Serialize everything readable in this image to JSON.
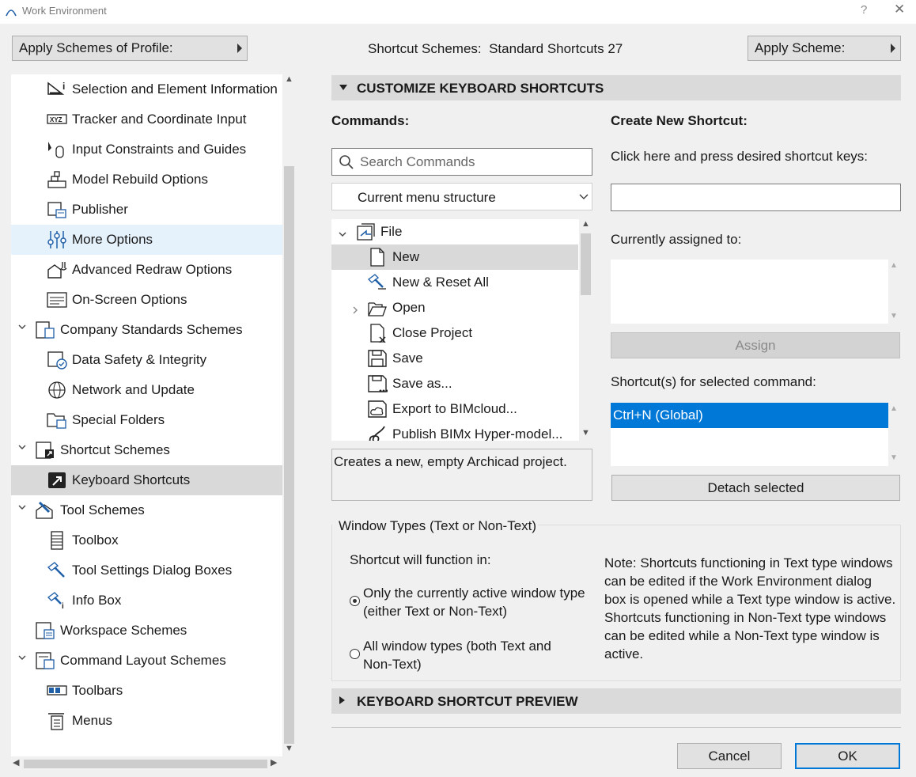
{
  "window": {
    "title": "Work Environment",
    "help": "?",
    "close": "✕"
  },
  "top": {
    "apply_profile": "Apply Schemes of Profile:",
    "scheme_label": "Shortcut Schemes",
    "scheme_sep": ":",
    "scheme_value": "Standard Shortcuts 27",
    "apply_scheme": "Apply Scheme:"
  },
  "tree": [
    {
      "label": "Selection and Element Information",
      "icon": "selection-info-icon",
      "level": 2
    },
    {
      "label": "Tracker and Coordinate Input",
      "icon": "xyz-tracker-icon",
      "level": 2
    },
    {
      "label": "Input Constraints and Guides",
      "icon": "cursor-mouse-icon",
      "level": 2
    },
    {
      "label": "Model Rebuild Options",
      "icon": "wall-rebuild-icon",
      "level": 2
    },
    {
      "label": "Publisher",
      "icon": "publisher-icon",
      "level": 2
    },
    {
      "label": "More Options",
      "icon": "sliders-icon",
      "level": 2
    },
    {
      "label": "Advanced Redraw Options",
      "icon": "redraw-icon",
      "level": 2
    },
    {
      "label": "On-Screen Options",
      "icon": "screen-options-icon",
      "level": 2
    },
    {
      "label": "Company Standards Schemes",
      "icon": "company-standards-icon",
      "level": 1
    },
    {
      "label": "Data Safety & Integrity",
      "icon": "data-safety-icon",
      "level": 2
    },
    {
      "label": "Network and Update",
      "icon": "globe-icon",
      "level": 2
    },
    {
      "label": "Special Folders",
      "icon": "folder-icon",
      "level": 2
    },
    {
      "label": "Shortcut Schemes",
      "icon": "shortcut-schemes-icon",
      "level": 1
    },
    {
      "label": "Keyboard Shortcuts",
      "icon": "keyboard-shortcut-icon",
      "level": 2
    },
    {
      "label": "Tool Schemes",
      "icon": "tool-schemes-icon",
      "level": 1
    },
    {
      "label": "Toolbox",
      "icon": "toolbox-icon",
      "level": 2
    },
    {
      "label": "Tool Settings Dialog Boxes",
      "icon": "tool-settings-icon",
      "level": 2
    },
    {
      "label": "Info Box",
      "icon": "info-box-icon",
      "level": 2
    },
    {
      "label": "Workspace Schemes",
      "icon": "workspace-icon",
      "level": 1
    },
    {
      "label": "Command Layout Schemes",
      "icon": "command-layout-icon",
      "level": 1
    },
    {
      "label": "Toolbars",
      "icon": "toolbars-icon",
      "level": 2
    },
    {
      "label": "Menus",
      "icon": "menus-icon",
      "level": 2
    }
  ],
  "customize": {
    "header": "CUSTOMIZE KEYBOARD SHORTCUTS",
    "commands_label": "Commands:",
    "search_placeholder": "Search Commands",
    "structure_select": "Current menu structure",
    "commands": [
      {
        "label": "File",
        "icon": "file-menu-icon"
      },
      {
        "label": "New",
        "icon": "new-document-icon"
      },
      {
        "label": "New & Reset All",
        "icon": "new-reset-icon"
      },
      {
        "label": "Open",
        "icon": "open-icon"
      },
      {
        "label": "Close Project",
        "icon": "close-project-icon"
      },
      {
        "label": "Save",
        "icon": "save-icon"
      },
      {
        "label": "Save as...",
        "icon": "save-as-icon"
      },
      {
        "label": "Export to BIMcloud...",
        "icon": "export-bimcloud-icon"
      },
      {
        "label": "Publish BIMx Hyper-model...",
        "icon": "bimx-icon"
      }
    ],
    "description": "Creates a new, empty Archicad project.",
    "create_label": "Create New Shortcut:",
    "click_here": "Click here and press desired shortcut keys:",
    "assigned_label": "Currently assigned to:",
    "assign_button": "Assign",
    "shortcuts_label": "Shortcut(s) for selected command:",
    "shortcuts": [
      "Ctrl+N (Global)"
    ],
    "detach_button": "Detach selected"
  },
  "window_types": {
    "title": "Window Types (Text or Non-Text)",
    "function_in": "Shortcut will function in:",
    "option1_line1": "Only the currently active window type",
    "option1_line2": "(either Text or Non-Text)",
    "option2_line1": "All window types (both Text and",
    "option2_line2": "Non-Text)",
    "selected": 1,
    "note_lines": [
      "Note: Shortcuts functioning in Text type windows",
      "can be edited if the Work Environment dialog",
      "box is opened while a Text type window is active.",
      "Shortcuts functioning in Non-Text type windows",
      "can be edited while a Non-Text type window is",
      "active."
    ]
  },
  "preview": {
    "header": "KEYBOARD SHORTCUT PREVIEW"
  },
  "footer": {
    "cancel": "Cancel",
    "ok": "OK"
  },
  "colors": {
    "accent": "#0078d7",
    "selection": "#d9d9d9",
    "hover": "#e5f1fb",
    "icon_blue": "#1f5fa8"
  }
}
